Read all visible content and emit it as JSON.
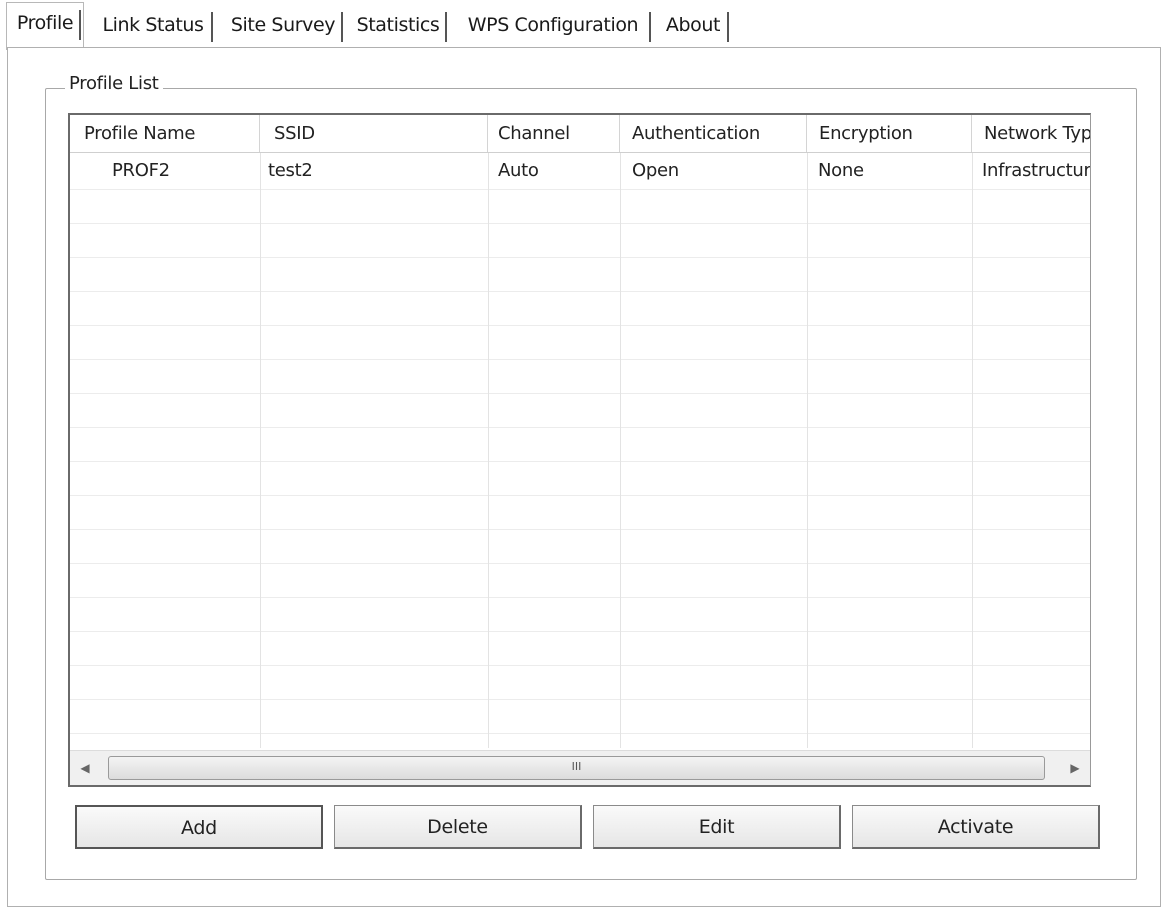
{
  "tabs": [
    {
      "label": "Profile",
      "active": true
    },
    {
      "label": "Link Status",
      "active": false
    },
    {
      "label": "Site Survey",
      "active": false
    },
    {
      "label": "Statistics",
      "active": false
    },
    {
      "label": "WPS Configuration",
      "active": false
    },
    {
      "label": "About",
      "active": false
    }
  ],
  "profile_list": {
    "group_label": "Profile List",
    "columns": [
      "Profile Name",
      "SSID",
      "Channel",
      "Authentication",
      "Encryption",
      "Network Type"
    ],
    "rows": [
      [
        "PROF2",
        "test2",
        "Auto",
        "Open",
        "None",
        "Infrastructure"
      ]
    ],
    "scroll_thumb_label": "III"
  },
  "buttons": {
    "add": "Add",
    "delete": "Delete",
    "edit": "Edit",
    "activate": "Activate"
  }
}
